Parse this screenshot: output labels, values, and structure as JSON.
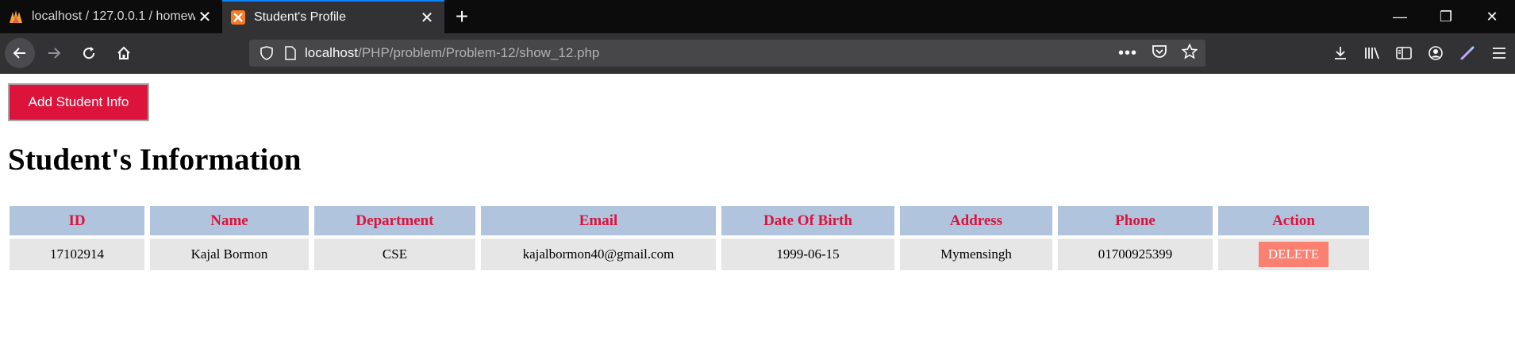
{
  "browser": {
    "tabs": [
      {
        "title": "localhost / 127.0.0.1 / homewo",
        "active": false
      },
      {
        "title": "Student's Profile",
        "active": true
      }
    ],
    "url_host": "localhost",
    "url_path": "/PHP/problem/Problem-12/show_12.php"
  },
  "page": {
    "add_button_label": "Add Student Info",
    "heading": "Student's Information",
    "table": {
      "headers": [
        "ID",
        "Name",
        "Department",
        "Email",
        "Date Of Birth",
        "Address",
        "Phone",
        "Action"
      ],
      "rows": [
        {
          "id": "17102914",
          "name": "Kajal Bormon",
          "department": "CSE",
          "email": "kajalbormon40@gmail.com",
          "dob": "1999-06-15",
          "address": "Mymensingh",
          "phone": "01700925399",
          "action_label": "DELETE"
        }
      ]
    }
  },
  "colors": {
    "add_button": "#dc143c",
    "header_bg": "#b0c4de",
    "header_text": "#dc143c",
    "cell_bg": "#e6e6e6",
    "delete_button": "#fa8072",
    "active_tab_accent": "#0a84ff"
  }
}
